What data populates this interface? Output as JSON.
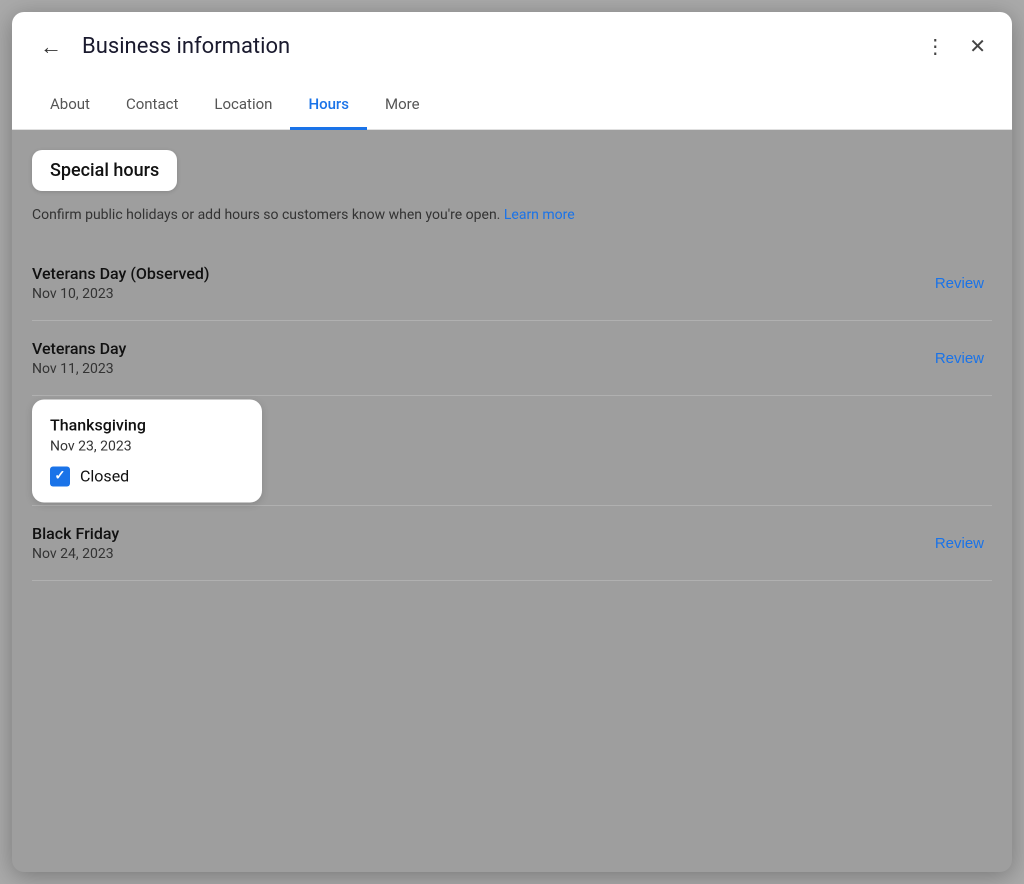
{
  "header": {
    "title": "Business information",
    "back_label": "←",
    "more_icon": "⋮",
    "close_icon": "✕"
  },
  "tabs": [
    {
      "id": "about",
      "label": "About",
      "active": false
    },
    {
      "id": "contact",
      "label": "Contact",
      "active": false
    },
    {
      "id": "location",
      "label": "Location",
      "active": false
    },
    {
      "id": "hours",
      "label": "Hours",
      "active": true
    },
    {
      "id": "more",
      "label": "More",
      "active": false
    }
  ],
  "special_hours": {
    "badge_label": "Special hours",
    "description": "Confirm public holidays or add hours so customers know when you're open.",
    "learn_more_label": "Learn more"
  },
  "holidays": [
    {
      "id": "veterans-day-observed",
      "name": "Veterans Day (Observed)",
      "date": "Nov 10, 2023",
      "action": "Review",
      "is_thanksgiving": false
    },
    {
      "id": "veterans-day",
      "name": "Veterans Day",
      "date": "Nov 11, 2023",
      "action": "Review",
      "is_thanksgiving": false
    },
    {
      "id": "thanksgiving",
      "name": "Thanksgiving",
      "date": "Nov 23, 2023",
      "action": null,
      "is_thanksgiving": true,
      "closed": true,
      "closed_label": "Closed"
    },
    {
      "id": "black-friday",
      "name": "Black Friday",
      "date": "Nov 24, 2023",
      "action": "Review",
      "is_thanksgiving": false
    }
  ]
}
